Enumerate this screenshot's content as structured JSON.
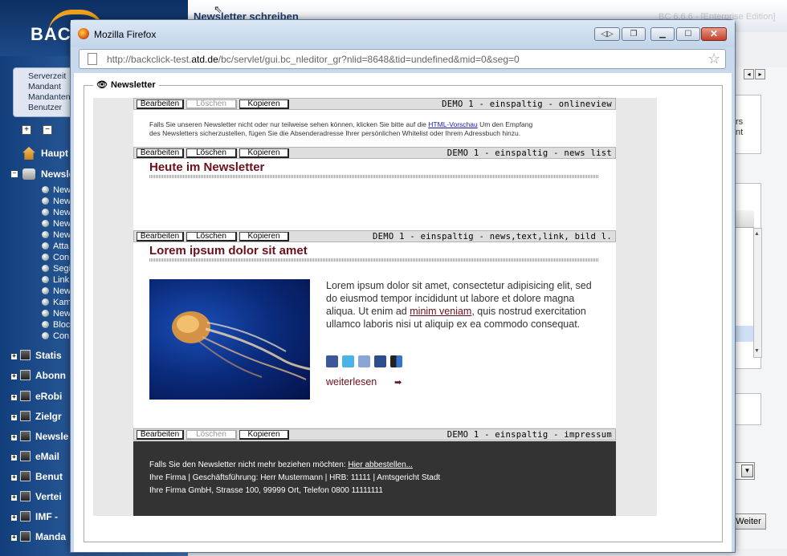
{
  "background_app": {
    "logo_text": "BAC",
    "title": "Newsletter schreiben",
    "version": "BC 6.6.6 - [Enterprise Edition]",
    "info_lines": [
      "Serverzeit",
      "Mandant",
      "Mandanten",
      "Benutzer"
    ],
    "nav_top_label": "Haupt",
    "nav_newsletter_label": "Newsle",
    "sub_items": [
      "New",
      "New",
      "New",
      "New",
      "New",
      "Atta",
      "Con",
      "Segi",
      "Link",
      "New",
      "Kam",
      "New",
      "Bloc",
      "Con"
    ],
    "groups": [
      "Statis",
      "Abonn",
      "eRobi",
      "Zielgr",
      "Newsle",
      "eMail",
      "Benut",
      "Vertei",
      "IMF -",
      "Manda"
    ],
    "right_text_1": "rs",
    "right_text_2": "nt",
    "weiter_label": "Weiter"
  },
  "browser": {
    "title": "Mozilla Firefox",
    "url_prefix": "http://backclick-test.",
    "url_domain": "atd.de",
    "url_suffix": "/bc/servlet/gui.bc_nleditor_gr?nlid=8648&tid=undefined&mid=0&seg=0"
  },
  "editor": {
    "legend": "Newsletter",
    "buttons": {
      "edit": "Bearbeiten",
      "delete": "Löschen",
      "copy": "Kopieren"
    },
    "blocks": [
      {
        "template": "DEMO 1 - einspaltig - onlineview"
      },
      {
        "template": "DEMO 1 - einspaltig - news list"
      },
      {
        "template": "DEMO 1 - einspaltig - news,text,link, bild l."
      },
      {
        "template": "DEMO 1 - einspaltig - impressum"
      }
    ],
    "online_view": {
      "text_before": "Falls Sie unseren Newsletter nicht oder nur teilweise sehen können, klicken Sie bitte auf die",
      "link": "HTML-Vorschau",
      "text_after": "Um den Empfang",
      "line2": "des Newsletters sicherzustellen, fügen Sie die Absenderadresse Ihrer persönlichen Whitelist oder Ihrem Adressbuch hinzu."
    },
    "news_list": {
      "heading": "Heute im Newsletter"
    },
    "article": {
      "heading": "Lorem ipsum dolor sit amet",
      "body_1": "Lorem ipsum dolor sit amet, consectetur adipisicing elit, sed do eiusmod tempor incididunt ut labore et dolore magna aliqua. Ut enim ad",
      "link": "minim veniam",
      "body_2": ", quis nostrud exercitation ullamco laboris nisi ut aliquip ex ea commodo consequat.",
      "read_more": "weiterlesen",
      "social_icons": [
        "facebook-icon",
        "twitter-icon",
        "google-icon",
        "myspace-icon",
        "delicious-icon"
      ]
    },
    "imprint": {
      "unsubscribe_text": "Falls Sie den Newsletter nicht mehr beziehen möchten:",
      "unsubscribe_link": "Hier abbestellen...",
      "line2": "Ihre Firma | Geschäftsführung: Herr Mustermann | HRB: 11111 | Amtsgericht Stadt",
      "line3": "Ihre Firma GmbH, Strasse 100, 99999 Ort, Telefon 0800 11111111"
    }
  },
  "colors": {
    "heading_red": "#6b0f1a",
    "footer_dark": "#333333",
    "link_blue": "#1a1aa6"
  }
}
